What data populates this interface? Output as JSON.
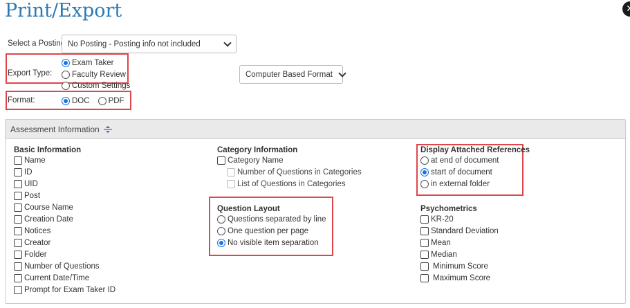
{
  "title": "Print/Export",
  "posting": {
    "label": "Select a Posting:",
    "selected": "No Posting - Posting info not included"
  },
  "export_type": {
    "label": "Export Type:",
    "options": [
      {
        "label": "Exam Taker",
        "selected": true
      },
      {
        "label": "Faculty Review",
        "selected": false
      },
      {
        "label": "Custom Settings",
        "selected": false
      }
    ]
  },
  "format_select": {
    "selected": "Computer Based Format"
  },
  "format": {
    "label": "Format:",
    "options": [
      {
        "label": "DOC",
        "selected": true
      },
      {
        "label": "PDF",
        "selected": false
      }
    ]
  },
  "assessment": {
    "header": "Assessment Information",
    "basic": {
      "title": "Basic Information",
      "items": [
        "Name",
        "ID",
        "UID",
        "Post",
        "Course Name",
        "Creation Date",
        "Notices",
        "Creator",
        "Folder",
        "Number of Questions",
        "Current Date/Time",
        "Prompt for Exam Taker ID"
      ]
    },
    "category": {
      "title": "Category Information",
      "items": [
        "Category Name",
        "Number of Questions in Categories",
        "List of Questions in Categories"
      ]
    },
    "question_layout": {
      "title": "Question Layout",
      "options": [
        {
          "label": "Questions separated by line",
          "selected": false
        },
        {
          "label": "One question per page",
          "selected": false
        },
        {
          "label": "No visible item separation",
          "selected": true
        }
      ]
    },
    "references": {
      "title": "Display Attached References",
      "options": [
        {
          "label": "at end of document",
          "selected": false
        },
        {
          "label": "start of document",
          "selected": true
        },
        {
          "label": "in external folder",
          "selected": false
        }
      ]
    },
    "psychometrics": {
      "title": "Psychometrics",
      "items": [
        "KR-20",
        "Standard Deviation",
        "Mean",
        "Median",
        "Minimum Score",
        "Maximum Score"
      ]
    }
  },
  "colors": {
    "accent": "#2b79b5",
    "highlight": "#e0454a",
    "radio": "#1a73e8"
  }
}
